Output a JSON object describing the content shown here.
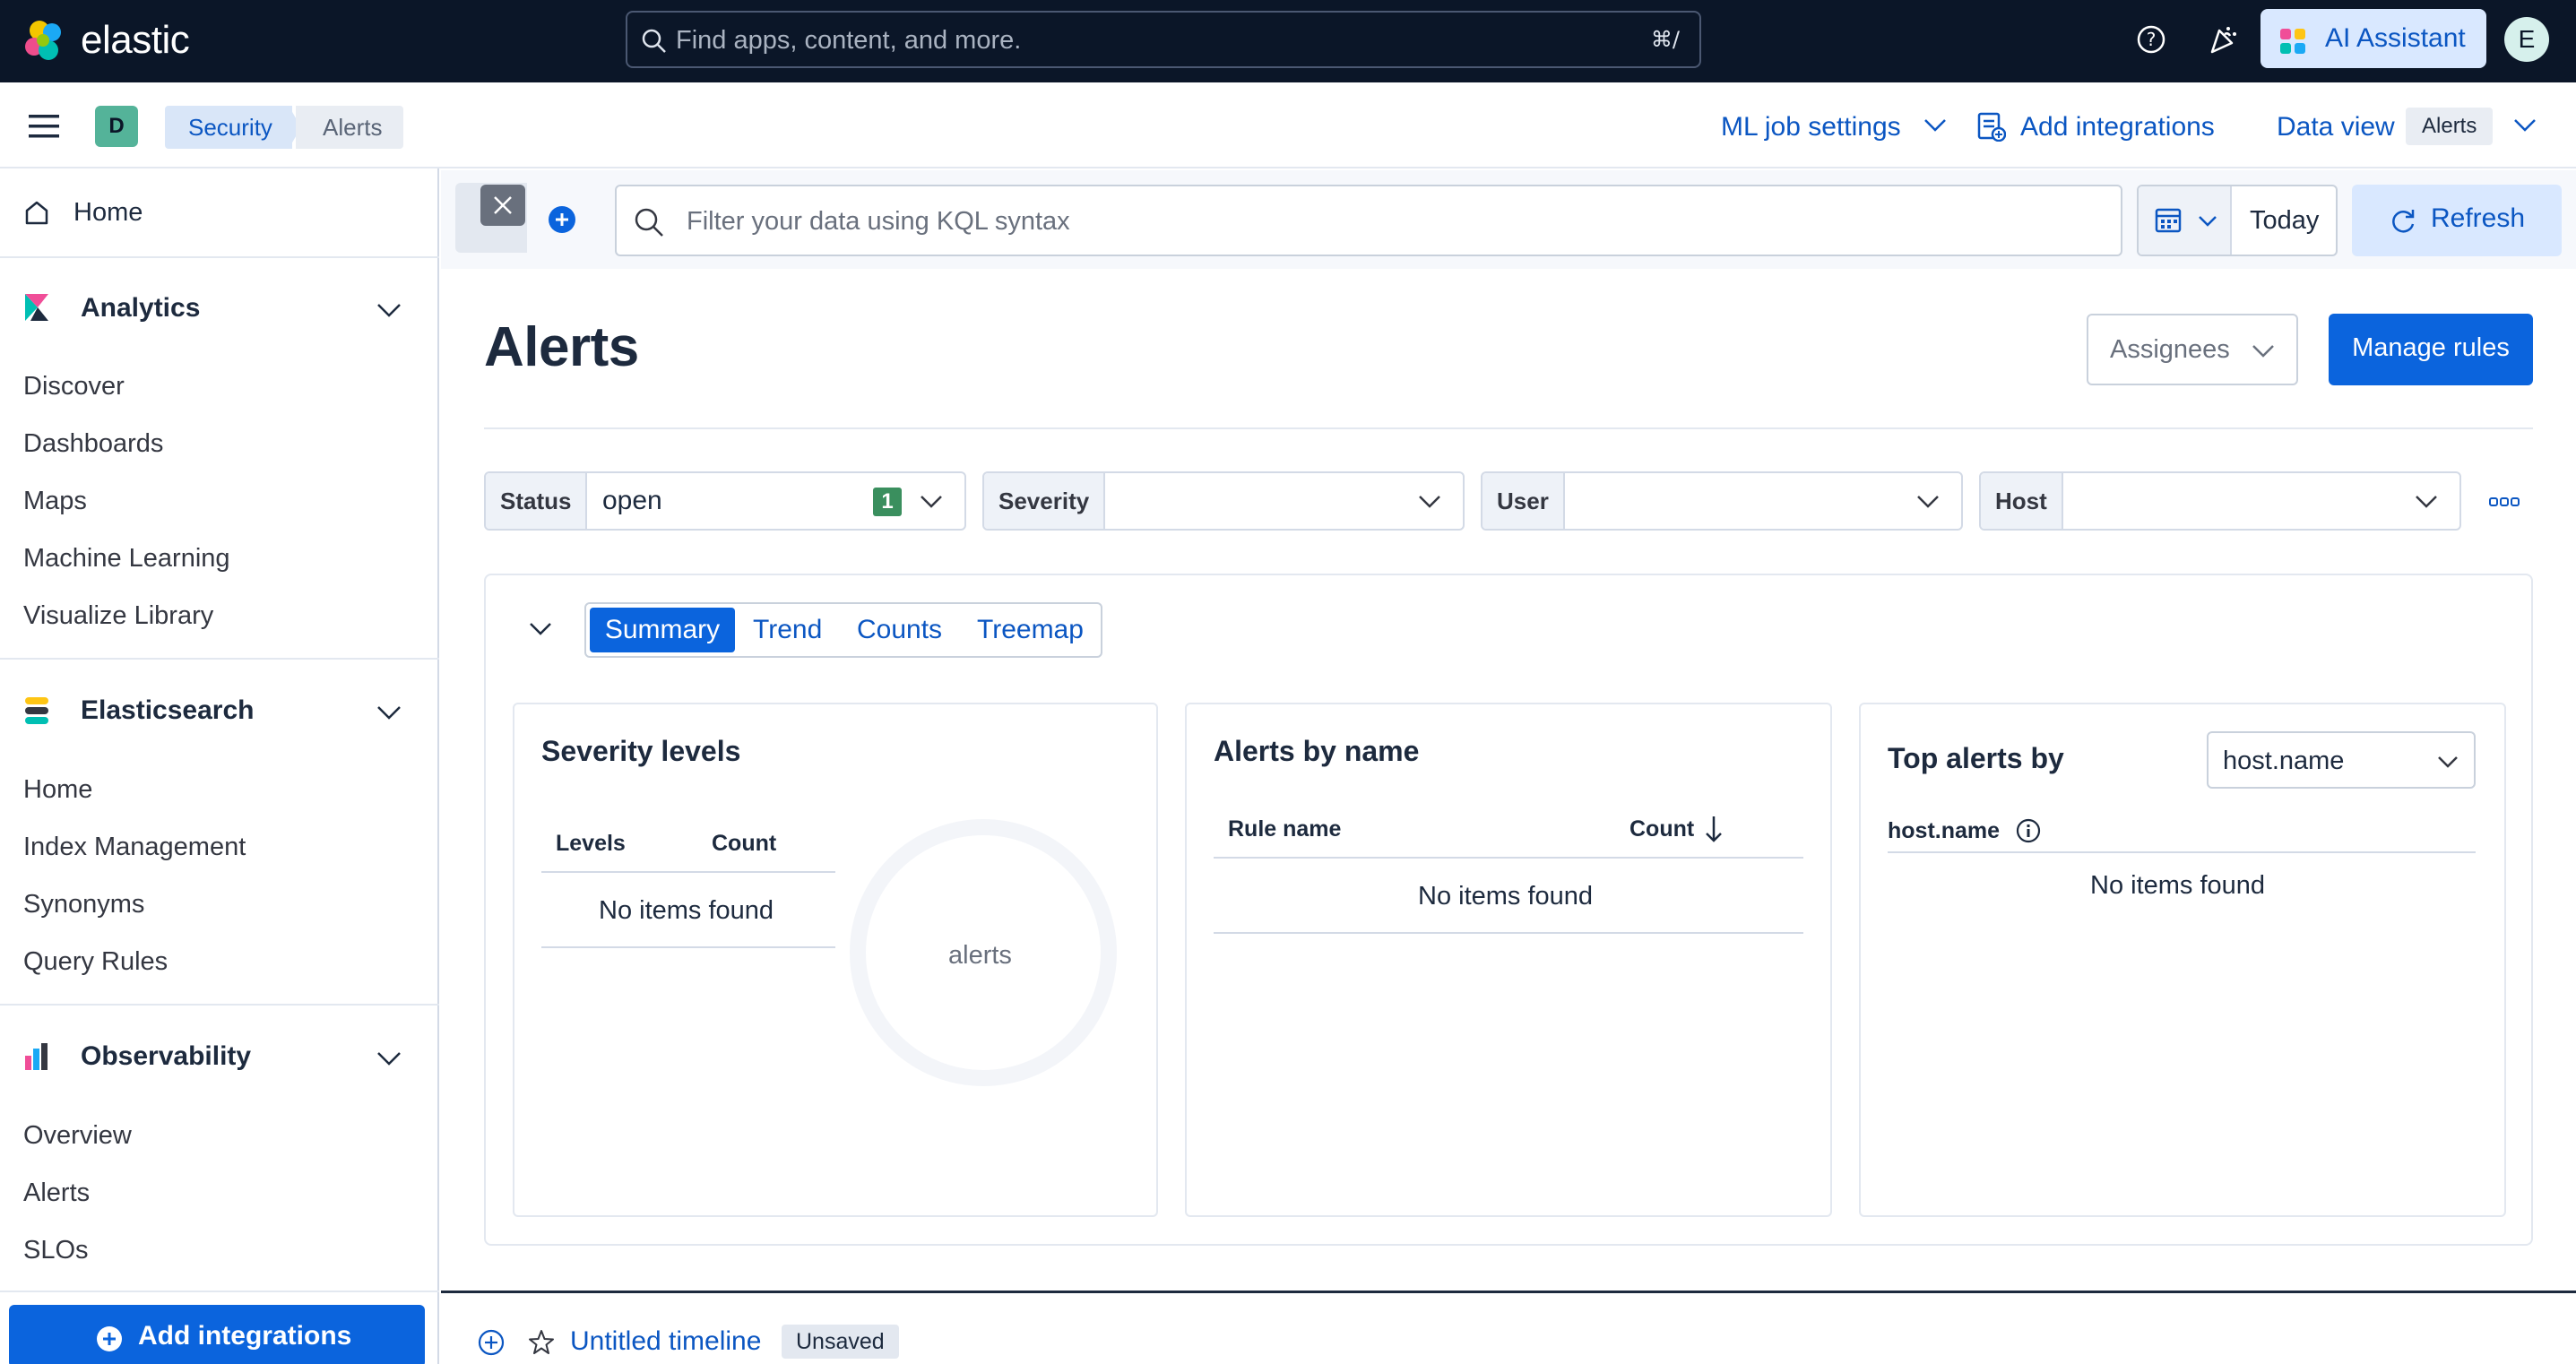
{
  "header": {
    "brand": "elastic",
    "search_placeholder": "Find apps, content, and more.",
    "search_shortcut": "⌘/",
    "ai_assistant_label": "AI Assistant",
    "user_initial": "E"
  },
  "subheader": {
    "space_initial": "D",
    "breadcrumbs": [
      "Security",
      "Alerts"
    ],
    "ml_job_settings": "ML job settings",
    "add_integrations": "Add integrations",
    "data_view_label": "Data view",
    "data_view_value": "Alerts"
  },
  "sidebar": {
    "home": "Home",
    "groups": [
      {
        "title": "Analytics",
        "items": [
          "Discover",
          "Dashboards",
          "Maps",
          "Machine Learning",
          "Visualize Library"
        ]
      },
      {
        "title": "Elasticsearch",
        "items": [
          "Home",
          "Index Management",
          "Synonyms",
          "Query Rules"
        ]
      },
      {
        "title": "Observability",
        "items": [
          "Overview",
          "Alerts",
          "SLOs"
        ]
      }
    ],
    "add_integrations": "Add integrations"
  },
  "querybar": {
    "placeholder": "Filter your data using KQL syntax",
    "date_label": "Today",
    "refresh_label": "Refresh"
  },
  "page": {
    "title": "Alerts",
    "assignees_label": "Assignees",
    "manage_rules_label": "Manage rules"
  },
  "filters": [
    {
      "label": "Status",
      "value": "open",
      "badge": "1"
    },
    {
      "label": "Severity",
      "value": ""
    },
    {
      "label": "User",
      "value": ""
    },
    {
      "label": "Host",
      "value": ""
    }
  ],
  "tabs": [
    "Summary",
    "Trend",
    "Counts",
    "Treemap"
  ],
  "active_tab": "Summary",
  "cards": {
    "severity": {
      "title": "Severity levels",
      "col_levels": "Levels",
      "col_count": "Count",
      "empty": "No items found",
      "donut_label": "alerts"
    },
    "by_name": {
      "title": "Alerts by name",
      "col_rule": "Rule name",
      "col_count": "Count",
      "empty": "No items found"
    },
    "top_by": {
      "title": "Top alerts by",
      "select_value": "host.name",
      "col_field": "host.name",
      "empty": "No items found"
    }
  },
  "timeline": {
    "title": "Untitled timeline",
    "status_badge": "Unsaved"
  },
  "colors": {
    "header_bg": "#0b1628",
    "primary": "#0b64dd",
    "link": "#0b56c2",
    "badge_green": "#3a8f5e"
  }
}
